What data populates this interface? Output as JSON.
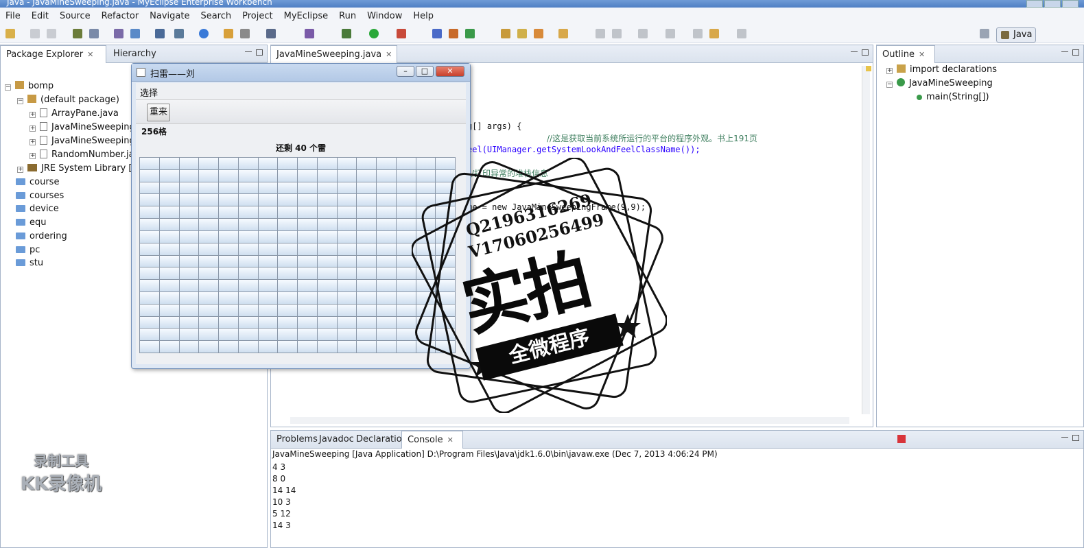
{
  "window": {
    "title": "Java - JavaMineSweeping.java - MyEclipse Enterprise Workbench"
  },
  "menu": [
    "File",
    "Edit",
    "Source",
    "Refactor",
    "Navigate",
    "Search",
    "Project",
    "MyEclipse",
    "Run",
    "Window",
    "Help"
  ],
  "perspective": {
    "label": "Java"
  },
  "package_explorer": {
    "tabs": [
      "Package Explorer",
      "Hierarchy"
    ],
    "tree": [
      {
        "label": "bomp",
        "kind": "project"
      },
      {
        "label": "(default package)",
        "kind": "package"
      },
      {
        "label": "ArrayPane.java",
        "kind": "file"
      },
      {
        "label": "JavaMineSweeping",
        "kind": "file"
      },
      {
        "label": "JavaMineSweeping",
        "kind": "file"
      },
      {
        "label": "RandomNumber.ja",
        "kind": "file"
      },
      {
        "label": "JRE System Library [jdl",
        "kind": "library"
      },
      {
        "label": "course",
        "kind": "folder"
      },
      {
        "label": "courses",
        "kind": "folder"
      },
      {
        "label": "device",
        "kind": "folder"
      },
      {
        "label": "equ",
        "kind": "folder"
      },
      {
        "label": "ordering",
        "kind": "folder"
      },
      {
        "label": "pc",
        "kind": "folder"
      },
      {
        "label": "stu",
        "kind": "folder"
      }
    ]
  },
  "editor": {
    "tab": "JavaMineSweeping.java",
    "lines": {
      "l1": "g[] args) {",
      "l2_comment": "//这是获取当前系统所运行的平台的程序外观。书上191页",
      "l3": "eel(UIManager.getSystemLookAndFeelClassName());",
      "l4_comment": "/打印异常的堆栈信息",
      "l5": "me = new JavaMineSweepingFrame(9,9);"
    }
  },
  "outline": {
    "tab": "Outline",
    "items": [
      "import declarations",
      "JavaMineSweeping",
      "main(String[])"
    ]
  },
  "bottom": {
    "tabs": [
      "Problems",
      "Javadoc",
      "Declaration",
      "Console"
    ],
    "console_header": "JavaMineSweeping [Java Application] D:\\Program Files\\Java\\jdk1.6.0\\bin\\javaw.exe (Dec 7, 2013 4:06:24 PM)",
    "console_lines": [
      "4  3",
      "8  0",
      "14  14",
      "10  3",
      "5  12",
      "14  3"
    ]
  },
  "minesweeper": {
    "title": "扫雷——刘",
    "menu": "选择",
    "restart": "重来",
    "cells_label": "256格",
    "remaining": "还剩  40  个雷",
    "grid": {
      "rows": 16,
      "cols": 16
    }
  },
  "watermark": {
    "qq": "Q2196316269",
    "wechat": "V17060256499",
    "big": "实拍",
    "banner": "全微程序"
  },
  "recorder": {
    "line1": "录制工具",
    "line2": "KK录像机"
  }
}
